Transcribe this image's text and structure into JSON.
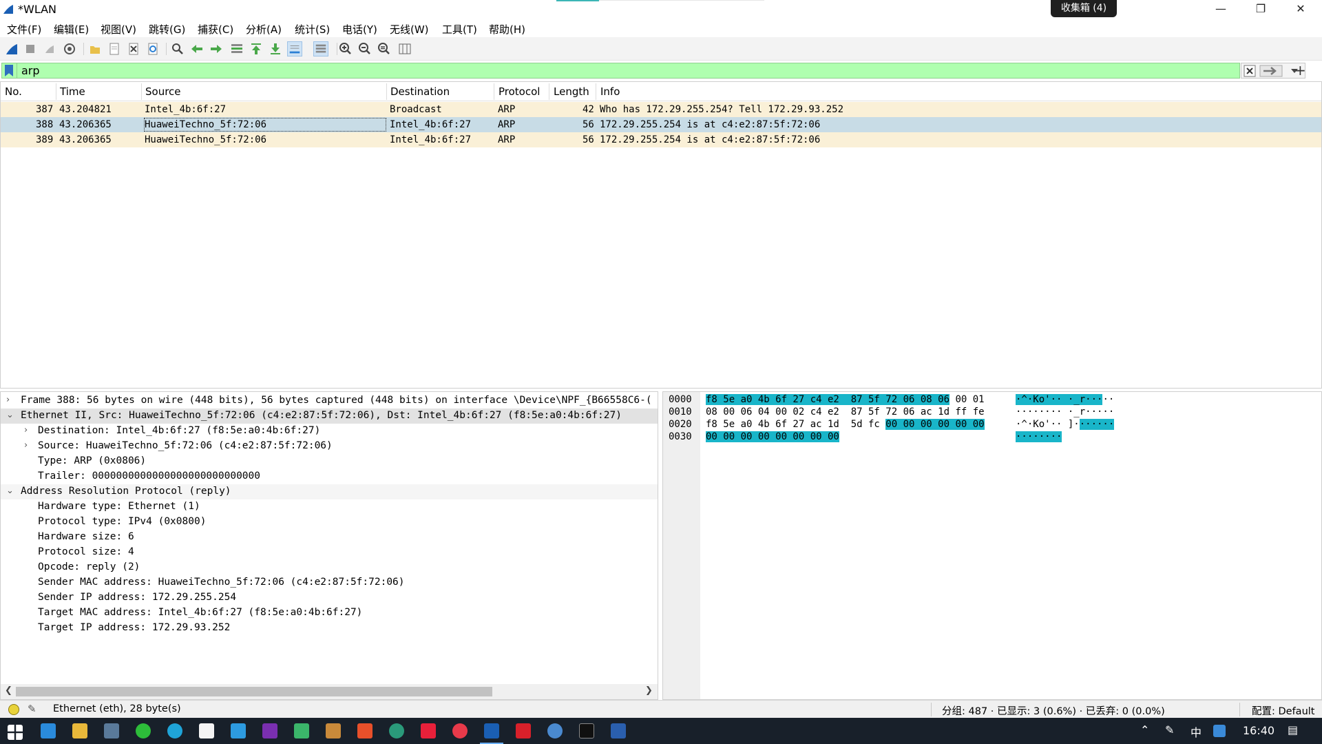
{
  "window": {
    "title": "*WLAN",
    "badge": "收集箱 (4)"
  },
  "menu": [
    "文件(F)",
    "编辑(E)",
    "视图(V)",
    "跳转(G)",
    "捕获(C)",
    "分析(A)",
    "统计(S)",
    "电话(Y)",
    "无线(W)",
    "工具(T)",
    "帮助(H)"
  ],
  "filter": {
    "value": "arp",
    "add_label": "+"
  },
  "packet_list": {
    "columns": [
      "No.",
      "Time",
      "Source",
      "Destination",
      "Protocol",
      "Length",
      "Info"
    ],
    "rows": [
      {
        "no": "387",
        "time": "43.204821",
        "source": "Intel_4b:6f:27",
        "destination": "Broadcast",
        "protocol": "ARP",
        "length": "42",
        "info": "Who has 172.29.255.254? Tell 172.29.93.252"
      },
      {
        "no": "388",
        "time": "43.206365",
        "source": "HuaweiTechno_5f:72:06",
        "destination": "Intel_4b:6f:27",
        "protocol": "ARP",
        "length": "56",
        "info": "172.29.255.254 is at c4:e2:87:5f:72:06"
      },
      {
        "no": "389",
        "time": "43.206365",
        "source": "HuaweiTechno_5f:72:06",
        "destination": "Intel_4b:6f:27",
        "protocol": "ARP",
        "length": "56",
        "info": "172.29.255.254 is at c4:e2:87:5f:72:06"
      }
    ],
    "row_colors": {
      "arp": "#faf0d7",
      "selected": "#c8dce6"
    }
  },
  "details": [
    "Frame 388: 56 bytes on wire (448 bits), 56 bytes captured (448 bits) on interface \\Device\\NPF_{B66558C6-(",
    "Ethernet II, Src: HuaweiTechno_5f:72:06 (c4:e2:87:5f:72:06), Dst: Intel_4b:6f:27 (f8:5e:a0:4b:6f:27)",
    "Destination: Intel_4b:6f:27 (f8:5e:a0:4b:6f:27)",
    "Source: HuaweiTechno_5f:72:06 (c4:e2:87:5f:72:06)",
    "Type: ARP (0x0806)",
    "Trailer: 0000000000000000000000000000",
    "Address Resolution Protocol (reply)",
    "Hardware type: Ethernet (1)",
    "Protocol type: IPv4 (0x0800)",
    "Hardware size: 6",
    "Protocol size: 4",
    "Opcode: reply (2)",
    "Sender MAC address: HuaweiTechno_5f:72:06 (c4:e2:87:5f:72:06)",
    "Sender IP address: 172.29.255.254",
    "Target MAC address: Intel_4b:6f:27 (f8:5e:a0:4b:6f:27)",
    "Target IP address: 172.29.93.252"
  ],
  "bytes": {
    "offsets": [
      "0000",
      "0010",
      "0020",
      "0030"
    ],
    "row0": {
      "hex_hl": "f8 5e a0 4b 6f 27 c4 e2  87 5f 72 06 08 06",
      "hex_rest": " 00 01",
      "ascii_hl": "·^·Ko'·· ·_r···",
      "ascii_rest": "··"
    },
    "row1": {
      "hex": "08 00 06 04 00 02 c4 e2  87 5f 72 06 ac 1d ff fe",
      "ascii": "········ ·_r·····"
    },
    "row2": {
      "hex_plain": "f8 5e a0 4b 6f 27 ac 1d  5d fc ",
      "hex_hl": "00 00 00 00 00 00",
      "ascii_plain": "·^·Ko'·· ]·",
      "ascii_hl": "······"
    },
    "row3": {
      "hex_hl": "00 00 00 00 00 00 00 00",
      "ascii_hl": "········"
    },
    "highlight_color": "#19b5c9"
  },
  "status": {
    "field_info": "Ethernet (eth), 28 byte(s)",
    "counts": "分组: 487 · 已显示: 3 (0.6%) · 已丢弃: 0 (0.0%)",
    "profile": "配置: Default"
  },
  "taskbar": {
    "clock": "16:40",
    "ime": "中"
  }
}
